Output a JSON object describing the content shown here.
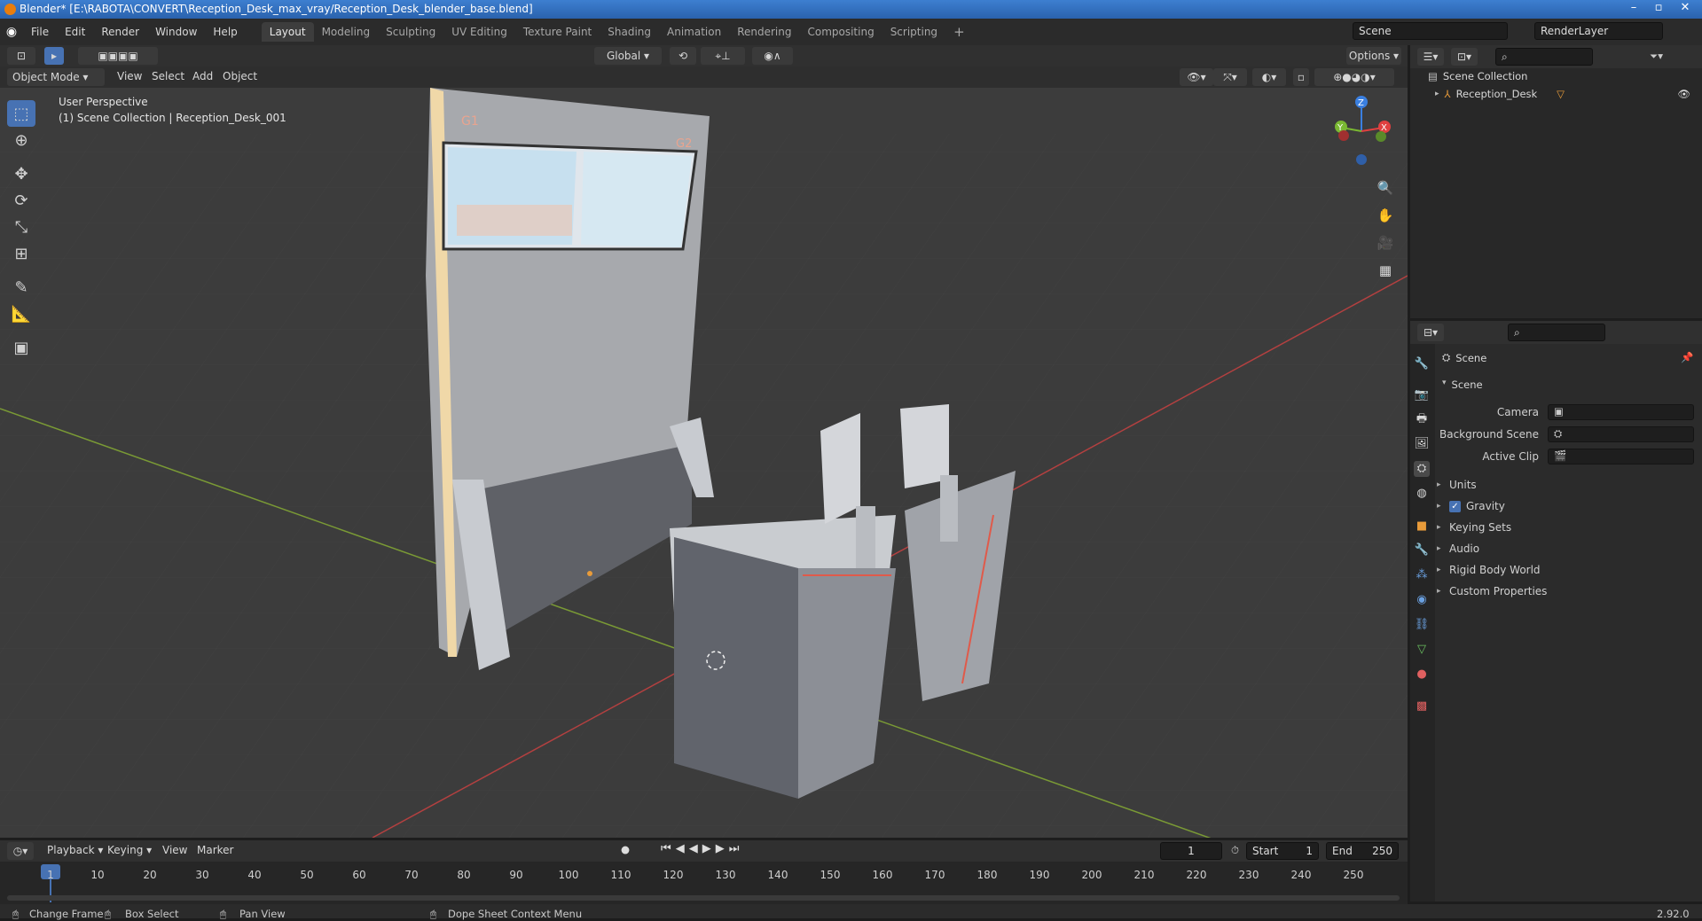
{
  "window": {
    "title": "Blender* [E:\\RABOTA\\CONVERT\\Reception_Desk_max_vray/Reception_Desk_blender_base.blend]"
  },
  "menu": [
    "File",
    "Edit",
    "Render",
    "Window",
    "Help"
  ],
  "workspaces": [
    "Layout",
    "Modeling",
    "Sculpting",
    "UV Editing",
    "Texture Paint",
    "Shading",
    "Animation",
    "Rendering",
    "Compositing",
    "Scripting"
  ],
  "scene_field": "Scene",
  "renderlayer_field": "RenderLayer",
  "viewport_header": {
    "transform_orientation": "Global",
    "options": "Options",
    "mode": "Object Mode",
    "menus": [
      "View",
      "Select",
      "Add",
      "Object"
    ]
  },
  "viewport_overlay": {
    "perspective": "User Perspective",
    "collection_info": "(1) Scene Collection | Reception_Desk_001"
  },
  "gizmo": {
    "z": "Z",
    "y": "Y",
    "x": "X"
  },
  "screen_labels": {
    "g1": "G1",
    "g2": "G2"
  },
  "outliner": {
    "root": "Scene Collection",
    "items": [
      {
        "label": "Reception_Desk"
      }
    ]
  },
  "properties": {
    "breadcrumb": "Scene",
    "panel_title": "Scene",
    "rows": [
      {
        "label": "Camera"
      },
      {
        "label": "Background Scene"
      },
      {
        "label": "Active Clip"
      }
    ],
    "subpanels": [
      "Units",
      "Gravity",
      "Keying Sets",
      "Audio",
      "Rigid Body World",
      "Custom Properties"
    ],
    "gravity_checked": true
  },
  "timeline": {
    "menus": [
      "Playback",
      "Keying",
      "View",
      "Marker"
    ],
    "current_frame": "1",
    "start_label": "Start",
    "start": "1",
    "end_label": "End",
    "end": "250",
    "ticks": [
      "1",
      "10",
      "20",
      "30",
      "40",
      "50",
      "60",
      "70",
      "80",
      "90",
      "100",
      "110",
      "120",
      "130",
      "140",
      "150",
      "160",
      "170",
      "180",
      "190",
      "200",
      "210",
      "220",
      "230",
      "240",
      "250"
    ]
  },
  "status_bar": {
    "items": [
      "Change Frame",
      "Box Select",
      "Pan View",
      "Dope Sheet Context Menu"
    ],
    "version": "2.92.0"
  },
  "colors": {
    "accent": "#4772b3",
    "title_bar": "#2f6bbf",
    "axis_x": "#e04040",
    "axis_y": "#7ab832",
    "axis_z": "#3a7fe0",
    "object_orange": "#e89b3a"
  }
}
